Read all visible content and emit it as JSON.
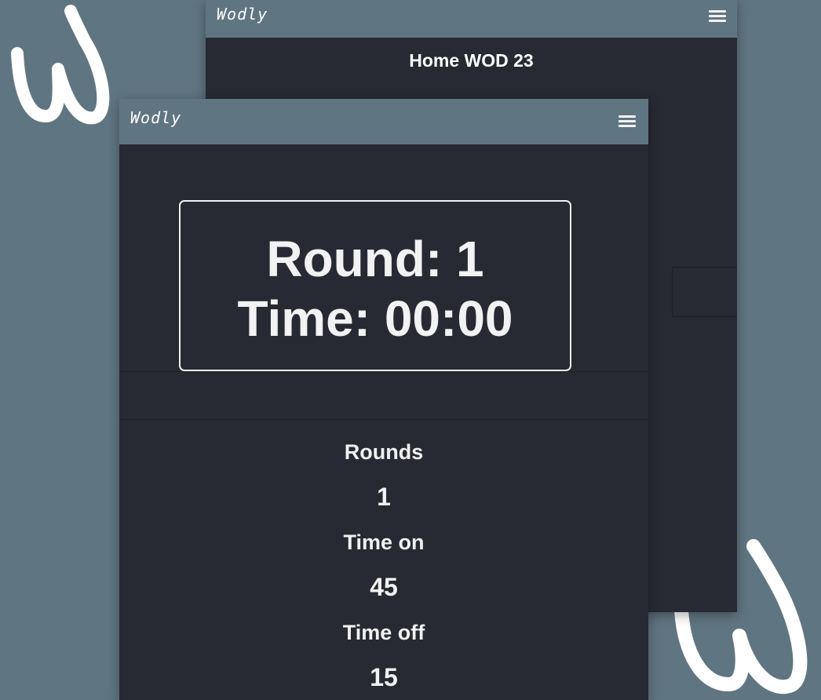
{
  "brand": {
    "name": "Wodly"
  },
  "colors": {
    "background": "#607582",
    "panel": "#272a32",
    "text": "#f2f2f2"
  },
  "back_screen": {
    "title": "Home WOD 23",
    "menu_icon": "hamburger-menu-icon"
  },
  "front_screen": {
    "menu_icon": "hamburger-menu-icon",
    "timer": {
      "round_text": "Round: 1",
      "time_text": "Time: 00:00"
    },
    "settings": {
      "rounds_label": "Rounds",
      "rounds_value": "1",
      "time_on_label": "Time on",
      "time_on_value": "45",
      "time_off_label": "Time off",
      "time_off_value": "15"
    }
  }
}
